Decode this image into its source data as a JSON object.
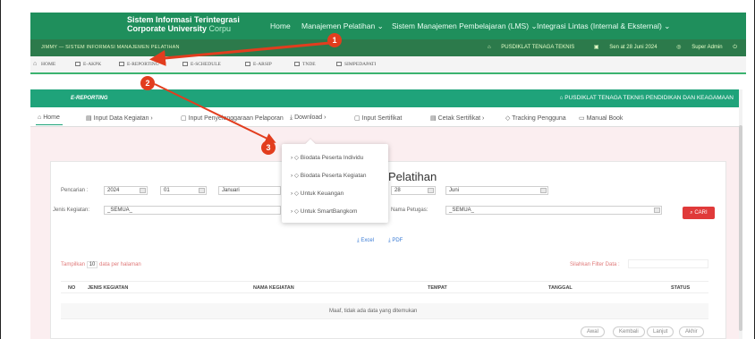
{
  "brand": {
    "line1": "Sistem Informasi Terintegrasi",
    "line2": "Corporate University",
    "line2_suffix": "Corpu"
  },
  "topnav": {
    "items": [
      "Home",
      "Manajemen Pelatihan",
      "Sistem Manajemen Pembelajaran (LMS)",
      "Integrasi Lintas (Internal & Eksternal)"
    ]
  },
  "infobar": {
    "left": "JIMMY — SISTEM INFORMASI MANAJEMEN PELATIHAN",
    "org": "PUSDIKLAT TENAGA TEKNIS",
    "date": "Sen at 28 Juni 2024",
    "user": "Super Admin"
  },
  "modules": [
    "HOME",
    "E-AKPK",
    "E-REPORTING",
    "E-SCHEDULE",
    "E-ARSIP",
    "TNDE",
    "SIMPEDAPATI"
  ],
  "panel": {
    "title": "E-REPORTING",
    "org": "PUSDIKLAT TENAGA TEKNIS PENDIDIKAN DAN KEAGAMAAN"
  },
  "subnav": {
    "items": [
      "Home",
      "Input Data Kegiatan",
      "Input Penyelenggaraan Pelaporan",
      "Download",
      "Input Sertifikat",
      "Cetak Sertifikat",
      "Tracking Pengguna",
      "Manual Book"
    ]
  },
  "dropdown": {
    "items": [
      "Biodata Peserta Individu",
      "Biodata Peserta Kegiatan",
      "Untuk Keuangan",
      "Untuk SmartBangkom"
    ]
  },
  "page": {
    "heading": "Pelatihan"
  },
  "filters": {
    "pencarian_label": "Pencarian :",
    "year": "2024",
    "month_num": "01",
    "month_name": "Januari",
    "day_end": "28",
    "month_end": "Juni",
    "jenis_label": "Jenis Kegiatan:",
    "jenis_value": "_SEMUA_",
    "petugas_label": "Nama Petugas:",
    "petugas_value": "_SEMUA_",
    "cari_label": "CARI"
  },
  "exports": {
    "excel": "Excel",
    "pdf": "PDF"
  },
  "table": {
    "show_prefix": "Tampilkan",
    "show_count": "10",
    "show_suffix": "data per halaman",
    "filter_label": "Silahkan Filter Data :",
    "headers": [
      "NO",
      "JENIS KEGIATAN",
      "NAMA KEGIATAN",
      "TEMPAT",
      "TANGGAL",
      "STATUS"
    ],
    "empty": "Maaf, tidak ada data yang ditemukan"
  },
  "pagination": [
    "Awal",
    "Kembali",
    "Lanjut",
    "Akhir"
  ],
  "markers": [
    "1",
    "2",
    "3"
  ],
  "colors": {
    "primary_green": "#1f8f5c",
    "marker_red": "#e23d1e"
  }
}
